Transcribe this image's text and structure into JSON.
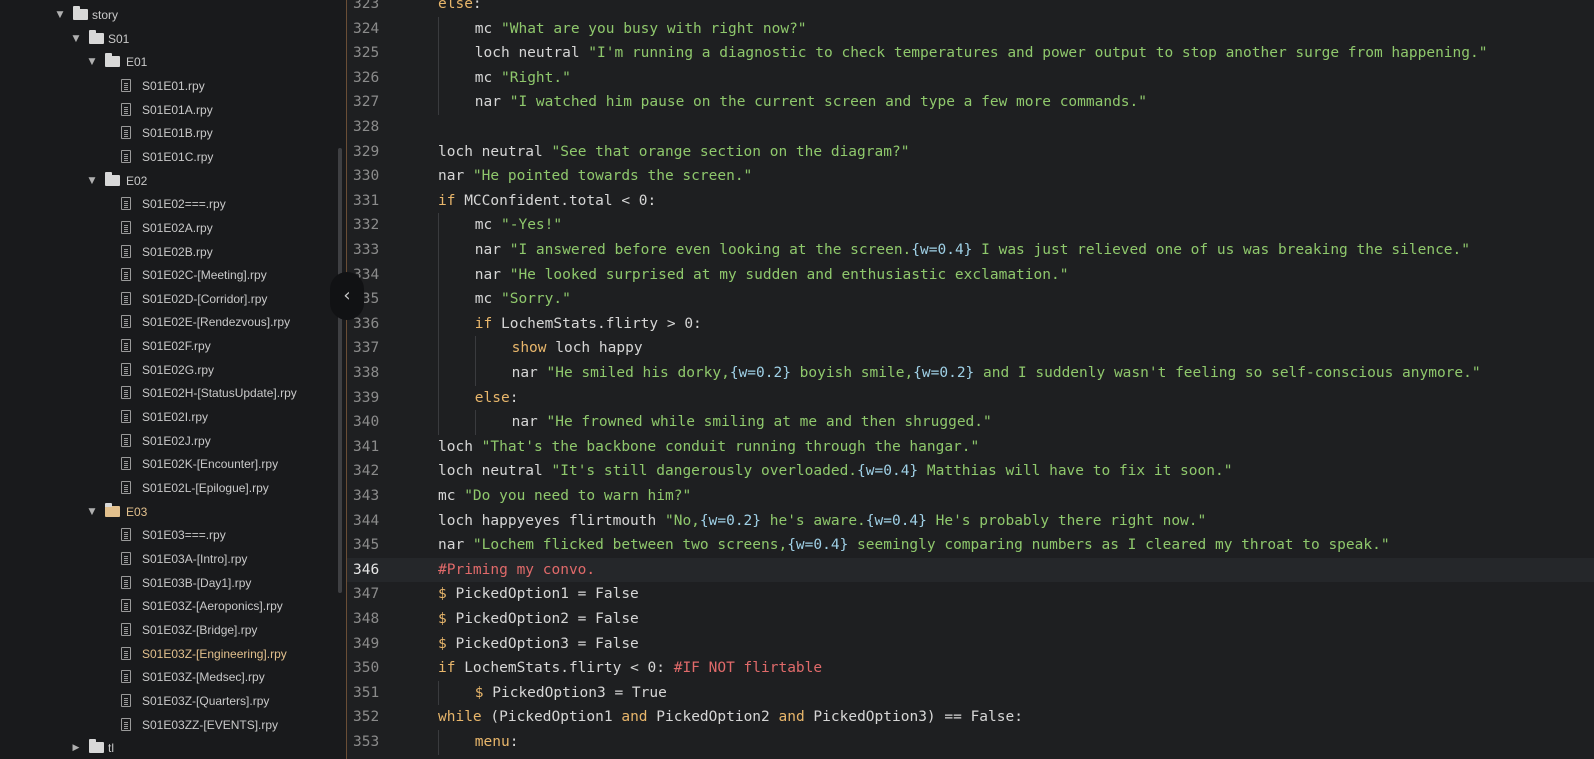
{
  "sidebar": {
    "collapse_glyph": "‹",
    "tree": [
      {
        "label": "story",
        "type": "folder",
        "depth": 0,
        "open": true
      },
      {
        "label": "S01",
        "type": "folder",
        "depth": 1,
        "open": true
      },
      {
        "label": "E01",
        "type": "folder",
        "depth": 2,
        "open": true
      },
      {
        "label": "S01E01.rpy",
        "type": "file",
        "depth": 3
      },
      {
        "label": "S01E01A.rpy",
        "type": "file",
        "depth": 3
      },
      {
        "label": "S01E01B.rpy",
        "type": "file",
        "depth": 3
      },
      {
        "label": "S01E01C.rpy",
        "type": "file",
        "depth": 3
      },
      {
        "label": "E02",
        "type": "folder",
        "depth": 2,
        "open": true
      },
      {
        "label": "S01E02===.rpy",
        "type": "file",
        "depth": 3
      },
      {
        "label": "S01E02A.rpy",
        "type": "file",
        "depth": 3
      },
      {
        "label": "S01E02B.rpy",
        "type": "file",
        "depth": 3
      },
      {
        "label": "S01E02C-[Meeting].rpy",
        "type": "file",
        "depth": 3
      },
      {
        "label": "S01E02D-[Corridor].rpy",
        "type": "file",
        "depth": 3
      },
      {
        "label": "S01E02E-[Rendezvous].rpy",
        "type": "file",
        "depth": 3
      },
      {
        "label": "S01E02F.rpy",
        "type": "file",
        "depth": 3
      },
      {
        "label": "S01E02G.rpy",
        "type": "file",
        "depth": 3
      },
      {
        "label": "S01E02H-[StatusUpdate].rpy",
        "type": "file",
        "depth": 3
      },
      {
        "label": "S01E02I.rpy",
        "type": "file",
        "depth": 3
      },
      {
        "label": "S01E02J.rpy",
        "type": "file",
        "depth": 3
      },
      {
        "label": "S01E02K-[Encounter].rpy",
        "type": "file",
        "depth": 3
      },
      {
        "label": "S01E02L-[Epilogue].rpy",
        "type": "file",
        "depth": 3
      },
      {
        "label": "E03",
        "type": "folder",
        "depth": 2,
        "open": true,
        "accent": true
      },
      {
        "label": "S01E03===.rpy",
        "type": "file",
        "depth": 3
      },
      {
        "label": "S01E03A-[Intro].rpy",
        "type": "file",
        "depth": 3
      },
      {
        "label": "S01E03B-[Day1].rpy",
        "type": "file",
        "depth": 3
      },
      {
        "label": "S01E03Z-[Aeroponics].rpy",
        "type": "file",
        "depth": 3
      },
      {
        "label": "S01E03Z-[Bridge].rpy",
        "type": "file",
        "depth": 3
      },
      {
        "label": "S01E03Z-[Engineering].rpy",
        "type": "file",
        "depth": 3,
        "active": true
      },
      {
        "label": "S01E03Z-[Medsec].rpy",
        "type": "file",
        "depth": 3
      },
      {
        "label": "S01E03Z-[Quarters].rpy",
        "type": "file",
        "depth": 3
      },
      {
        "label": "S01E03ZZ-[EVENTS].rpy",
        "type": "file",
        "depth": 3
      },
      {
        "label": "tl",
        "type": "folder",
        "depth": 1,
        "open": false
      }
    ]
  },
  "editor": {
    "current_line": 346,
    "lines": [
      {
        "n": 323,
        "indent": 0,
        "tokens": [
          [
            "kw",
            "else"
          ],
          [
            "p",
            ":"
          ]
        ]
      },
      {
        "n": 324,
        "indent": 1,
        "tokens": [
          [
            "p",
            "mc "
          ],
          [
            "str",
            "\"What are you busy with right now?\""
          ]
        ]
      },
      {
        "n": 325,
        "indent": 1,
        "tokens": [
          [
            "p",
            "loch neutral "
          ],
          [
            "str",
            "\"I'm running a diagnostic to check temperatures and power output to stop another surge from happening.\""
          ]
        ]
      },
      {
        "n": 326,
        "indent": 1,
        "tokens": [
          [
            "p",
            "mc "
          ],
          [
            "str",
            "\"Right.\""
          ]
        ]
      },
      {
        "n": 327,
        "indent": 1,
        "tokens": [
          [
            "p",
            "nar "
          ],
          [
            "str",
            "\"I watched him pause on the current screen and type a few more commands.\""
          ]
        ]
      },
      {
        "n": 328,
        "indent": 0,
        "tokens": []
      },
      {
        "n": 329,
        "indent": 0,
        "tokens": [
          [
            "p",
            "loch neutral "
          ],
          [
            "str",
            "\"See that orange section on the diagram?\""
          ]
        ]
      },
      {
        "n": 330,
        "indent": 0,
        "tokens": [
          [
            "p",
            "nar "
          ],
          [
            "str",
            "\"He pointed towards the screen.\""
          ]
        ]
      },
      {
        "n": 331,
        "indent": 0,
        "tokens": [
          [
            "kw",
            "if"
          ],
          [
            "p",
            " MCConfident.total < 0:"
          ]
        ]
      },
      {
        "n": 332,
        "indent": 1,
        "tokens": [
          [
            "p",
            "mc "
          ],
          [
            "str",
            "\"-Yes!\""
          ]
        ]
      },
      {
        "n": 333,
        "indent": 1,
        "tokens": [
          [
            "p",
            "nar "
          ],
          [
            "str",
            "\"I answered before even looking at the screen."
          ],
          [
            "tag",
            "{w=0.4}"
          ],
          [
            "str",
            " I was just relieved one of us was breaking the silence.\""
          ]
        ]
      },
      {
        "n": 334,
        "indent": 1,
        "tokens": [
          [
            "p",
            "nar "
          ],
          [
            "str",
            "\"He looked surprised at my sudden and enthusiastic exclamation.\""
          ]
        ]
      },
      {
        "n": 335,
        "indent": 1,
        "tokens": [
          [
            "p",
            "mc "
          ],
          [
            "str",
            "\"Sorry.\""
          ]
        ]
      },
      {
        "n": 336,
        "indent": 1,
        "tokens": [
          [
            "kw",
            "if"
          ],
          [
            "p",
            " LochemStats.flirty > 0:"
          ]
        ]
      },
      {
        "n": 337,
        "indent": 2,
        "tokens": [
          [
            "kw",
            "show"
          ],
          [
            "p",
            " loch happy"
          ]
        ]
      },
      {
        "n": 338,
        "indent": 2,
        "tokens": [
          [
            "p",
            "nar "
          ],
          [
            "str",
            "\"He smiled his dorky,"
          ],
          [
            "tag",
            "{w=0.2}"
          ],
          [
            "str",
            " boyish smile,"
          ],
          [
            "tag",
            "{w=0.2}"
          ],
          [
            "str",
            " and I suddenly wasn't feeling so self-conscious anymore.\""
          ]
        ]
      },
      {
        "n": 339,
        "indent": 1,
        "tokens": [
          [
            "kw",
            "else"
          ],
          [
            "p",
            ":"
          ]
        ]
      },
      {
        "n": 340,
        "indent": 2,
        "tokens": [
          [
            "p",
            "nar "
          ],
          [
            "str",
            "\"He frowned while smiling at me and then shrugged.\""
          ]
        ]
      },
      {
        "n": 341,
        "indent": 0,
        "tokens": [
          [
            "p",
            "loch "
          ],
          [
            "str",
            "\"That's the backbone conduit running through the hangar.\""
          ]
        ]
      },
      {
        "n": 342,
        "indent": 0,
        "tokens": [
          [
            "p",
            "loch neutral "
          ],
          [
            "str",
            "\"It's still dangerously overloaded."
          ],
          [
            "tag",
            "{w=0.4}"
          ],
          [
            "str",
            " Matthias will have to fix it soon.\""
          ]
        ]
      },
      {
        "n": 343,
        "indent": 0,
        "tokens": [
          [
            "p",
            "mc "
          ],
          [
            "str",
            "\"Do you need to warn him?\""
          ]
        ]
      },
      {
        "n": 344,
        "indent": 0,
        "tokens": [
          [
            "p",
            "loch happyeyes flirtmouth "
          ],
          [
            "str",
            "\"No,"
          ],
          [
            "tag",
            "{w=0.2}"
          ],
          [
            "str",
            " he's aware."
          ],
          [
            "tag",
            "{w=0.4}"
          ],
          [
            "str",
            " He's probably there right now.\""
          ]
        ]
      },
      {
        "n": 345,
        "indent": 0,
        "tokens": [
          [
            "p",
            "nar "
          ],
          [
            "str",
            "\"Lochem flicked between two screens,"
          ],
          [
            "tag",
            "{w=0.4}"
          ],
          [
            "str",
            " seemingly comparing numbers as I cleared my throat to speak.\""
          ]
        ]
      },
      {
        "n": 346,
        "indent": 0,
        "tokens": [
          [
            "cmt",
            "#Priming my convo."
          ]
        ]
      },
      {
        "n": 347,
        "indent": 0,
        "tokens": [
          [
            "kw",
            "$"
          ],
          [
            "p",
            " PickedOption1 = False"
          ]
        ]
      },
      {
        "n": 348,
        "indent": 0,
        "tokens": [
          [
            "kw",
            "$"
          ],
          [
            "p",
            " PickedOption2 = False"
          ]
        ]
      },
      {
        "n": 349,
        "indent": 0,
        "tokens": [
          [
            "kw",
            "$"
          ],
          [
            "p",
            " PickedOption3 = False"
          ]
        ]
      },
      {
        "n": 350,
        "indent": 0,
        "tokens": [
          [
            "kw",
            "if"
          ],
          [
            "p",
            " LochemStats.flirty < 0: "
          ],
          [
            "cmt",
            "#IF NOT flirtable"
          ]
        ]
      },
      {
        "n": 351,
        "indent": 1,
        "tokens": [
          [
            "kw",
            "$"
          ],
          [
            "p",
            " PickedOption3 = True"
          ]
        ]
      },
      {
        "n": 352,
        "indent": 0,
        "tokens": [
          [
            "kw",
            "while"
          ],
          [
            "p",
            " (PickedOption1 "
          ],
          [
            "kw",
            "and"
          ],
          [
            "p",
            " PickedOption2 "
          ],
          [
            "kw",
            "and"
          ],
          [
            "p",
            " PickedOption3) == False:"
          ]
        ]
      },
      {
        "n": 353,
        "indent": 1,
        "tokens": [
          [
            "kw",
            "menu"
          ],
          [
            "p",
            ":"
          ]
        ]
      }
    ]
  }
}
